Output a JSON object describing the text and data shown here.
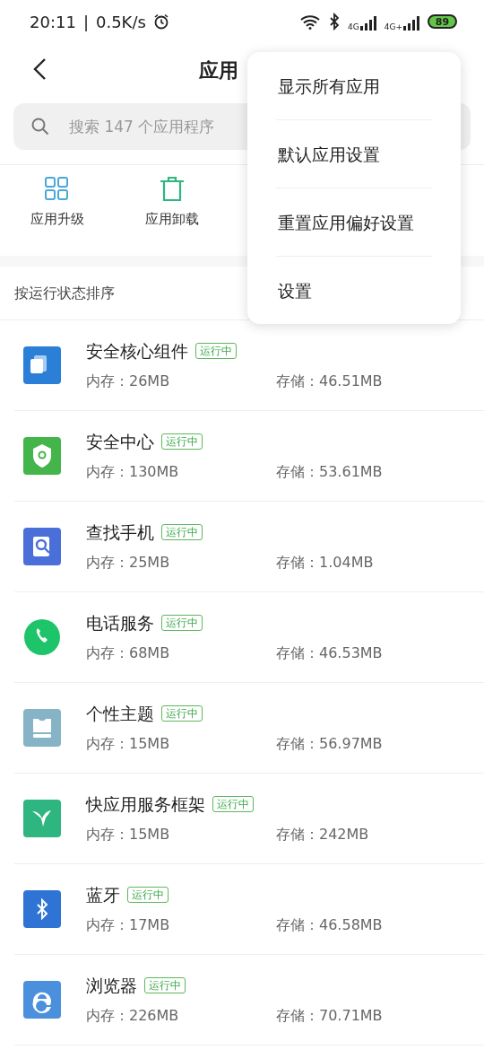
{
  "status_bar": {
    "time": "20:11",
    "separator": "|",
    "speed": "0.5K/s",
    "network_1": "4G",
    "network_2": "4G+",
    "battery": "89"
  },
  "header": {
    "title": "应用"
  },
  "search": {
    "placeholder": "搜索 147 个应用程序"
  },
  "toolbar": [
    {
      "label": "应用升级"
    },
    {
      "label": "应用卸载"
    }
  ],
  "sort": {
    "label": "按运行状态排序"
  },
  "apps": [
    {
      "name": "安全核心组件",
      "status": "运行中",
      "memory": "内存：26MB",
      "storage": "存储：46.51MB",
      "color": "#2b7fd6"
    },
    {
      "name": "安全中心",
      "status": "运行中",
      "memory": "内存：130MB",
      "storage": "存储：53.61MB",
      "color": "#43b54a"
    },
    {
      "name": "查找手机",
      "status": "运行中",
      "memory": "内存：25MB",
      "storage": "存储：1.04MB",
      "color": "#4a6fd8"
    },
    {
      "name": "电话服务",
      "status": "运行中",
      "memory": "内存：68MB",
      "storage": "存储：46.53MB",
      "color": "#1ec46a"
    },
    {
      "name": "个性主题",
      "status": "运行中",
      "memory": "内存：15MB",
      "storage": "存储：56.97MB",
      "color": "#86b3c6"
    },
    {
      "name": "快应用服务框架",
      "status": "运行中",
      "memory": "内存：15MB",
      "storage": "存储：242MB",
      "color": "#2fb57f"
    },
    {
      "name": "蓝牙",
      "status": "运行中",
      "memory": "内存：17MB",
      "storage": "存储：46.58MB",
      "color": "#2f74d4"
    },
    {
      "name": "浏览器",
      "status": "运行中",
      "memory": "内存：226MB",
      "storage": "存储：70.71MB",
      "color": "#4a90dc"
    }
  ],
  "menu": [
    {
      "label": "显示所有应用"
    },
    {
      "label": "默认应用设置"
    },
    {
      "label": "重置应用偏好设置"
    },
    {
      "label": "设置"
    }
  ]
}
